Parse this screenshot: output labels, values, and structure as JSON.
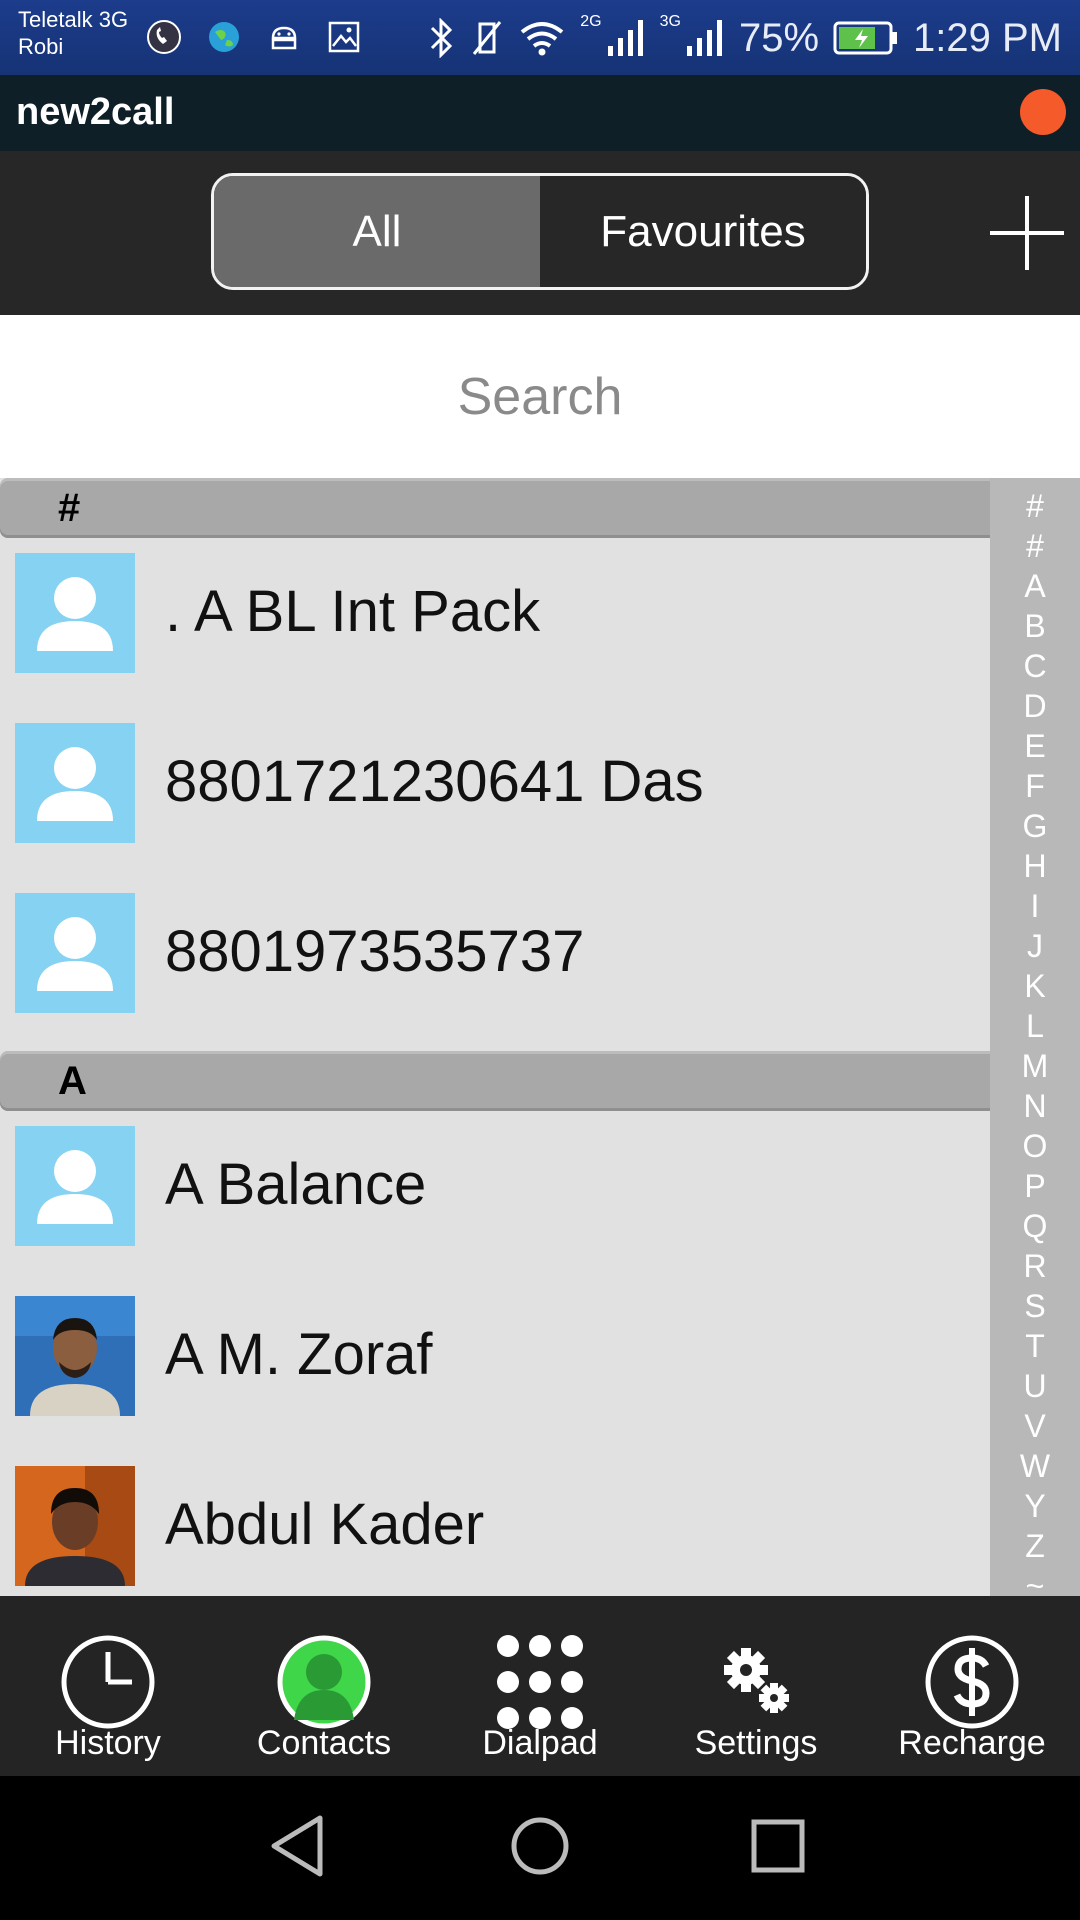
{
  "status_bar": {
    "carrier_line1": "Teletalk 3G",
    "carrier_line2": "Robi",
    "signal1_label": "2G",
    "signal2_label": "3G",
    "battery": "75%",
    "time": "1:29 PM"
  },
  "app": {
    "title": "new2call",
    "status_color": "#f45a2a"
  },
  "tabs": [
    {
      "label": "All",
      "active": true
    },
    {
      "label": "Favourites",
      "active": false
    }
  ],
  "search": {
    "placeholder": "Search",
    "value": ""
  },
  "sections": [
    {
      "header": "#",
      "contacts": [
        {
          "name": ". A BL Int Pack",
          "avatar": "default-avatar-icon"
        },
        {
          "name": "8801721230641 Das",
          "avatar": "default-avatar-icon"
        },
        {
          "name": "8801973535737",
          "avatar": "default-avatar-icon"
        }
      ]
    },
    {
      "header": "A",
      "contacts": [
        {
          "name": "A Balance",
          "avatar": "default-avatar-icon"
        },
        {
          "name": "A M. Zoraf",
          "avatar": "photo"
        },
        {
          "name": "Abdul Kader",
          "avatar": "photo"
        }
      ]
    }
  ],
  "alpha_index": [
    "#",
    "#",
    "A",
    "B",
    "C",
    "D",
    "E",
    "F",
    "G",
    "H",
    "I",
    "J",
    "K",
    "L",
    "M",
    "N",
    "O",
    "P",
    "Q",
    "R",
    "S",
    "T",
    "U",
    "V",
    "W",
    "Y",
    "Z",
    "~"
  ],
  "bottom_nav": [
    {
      "label": "History",
      "icon": "clock-icon"
    },
    {
      "label": "Contacts",
      "icon": "person-icon",
      "active": true
    },
    {
      "label": "Dialpad",
      "icon": "dialpad-icon"
    },
    {
      "label": "Settings",
      "icon": "gear-icon"
    },
    {
      "label": "Recharge",
      "icon": "dollar-icon"
    }
  ],
  "colors": {
    "active_nav": "#3fd64a",
    "avatar_bg": "#85d2f2"
  }
}
